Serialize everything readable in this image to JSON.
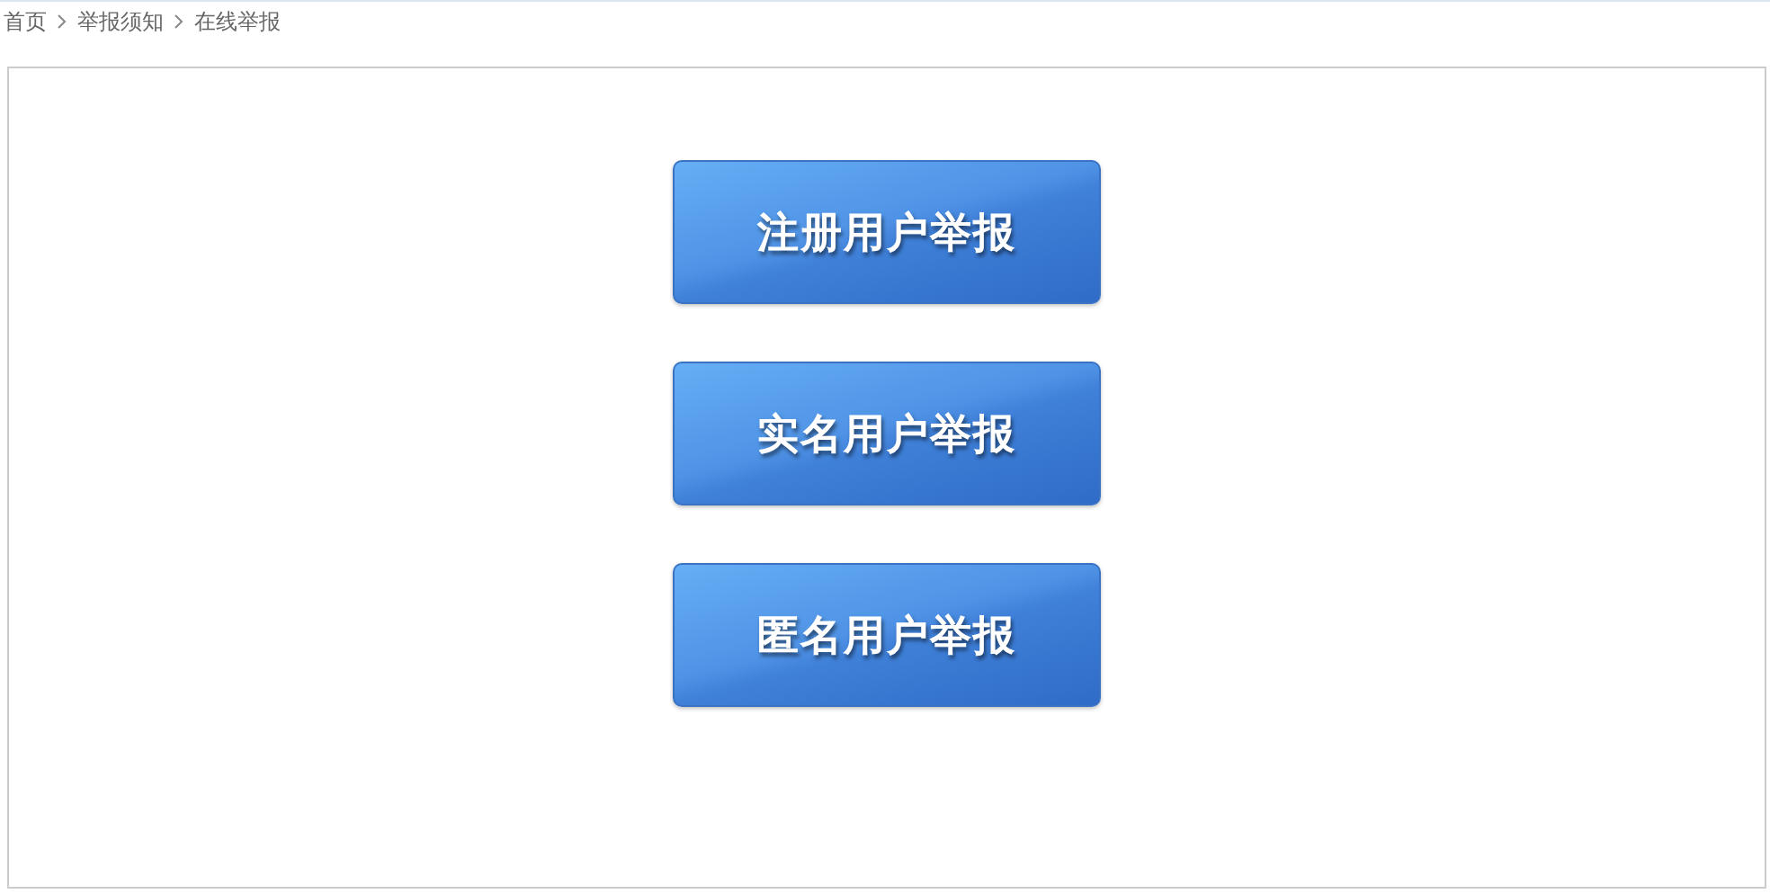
{
  "breadcrumb": [
    {
      "label": "首页"
    },
    {
      "label": "举报须知"
    },
    {
      "label": "在线举报"
    }
  ],
  "report_buttons": [
    {
      "label": "注册用户举报"
    },
    {
      "label": "实名用户举报"
    },
    {
      "label": "匿名用户举报"
    }
  ]
}
